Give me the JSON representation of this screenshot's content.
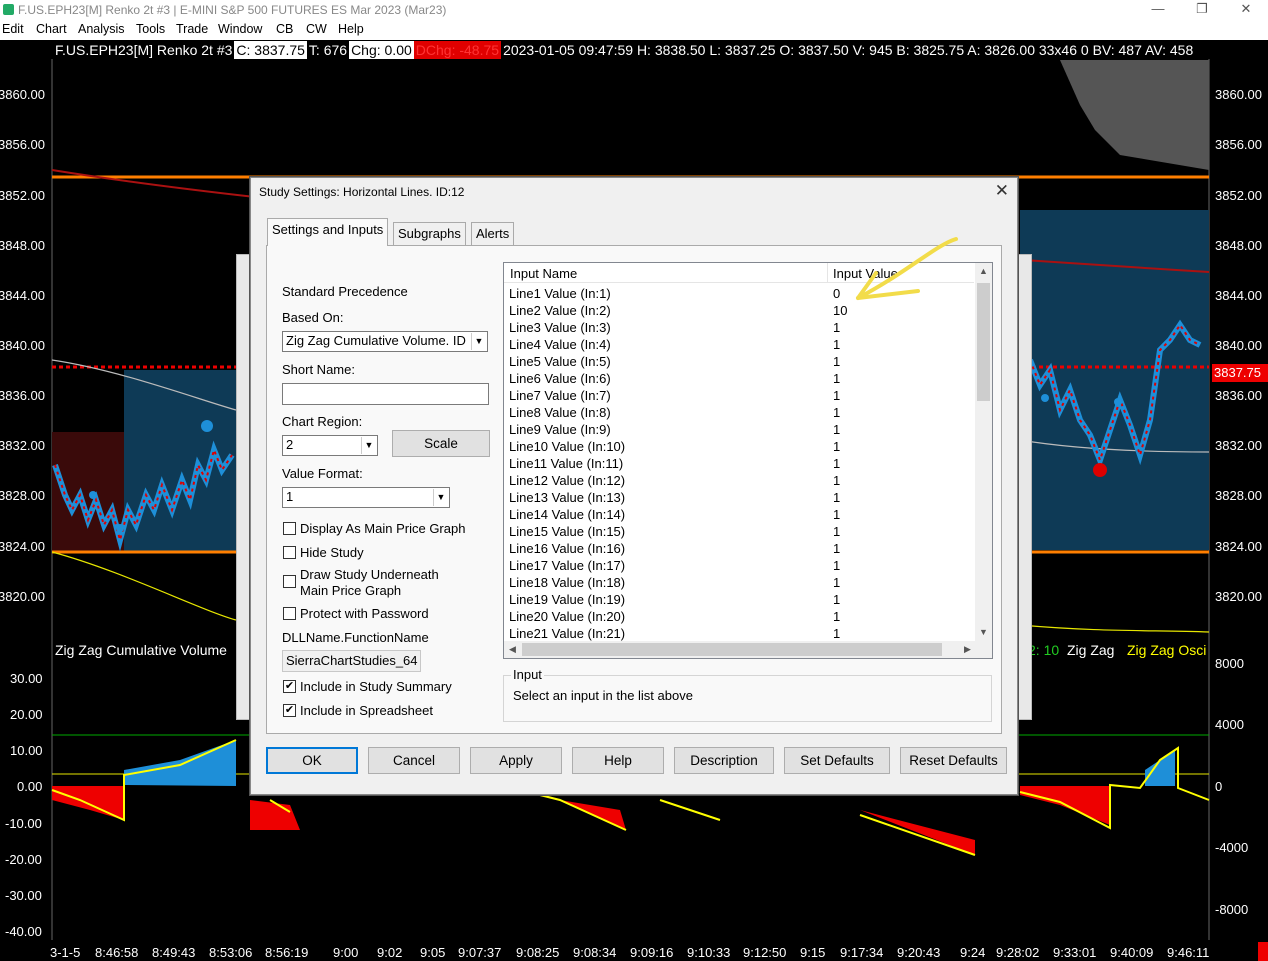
{
  "window": {
    "title": "F.US.EPH23[M]  Renko 2t  #3 | E-MINI S&P 500 FUTURES ES Mar 2023 (Mar23)",
    "minimize": "—",
    "restore": "❐",
    "close": "✕"
  },
  "menu": [
    "Edit",
    "Chart",
    "Analysis",
    "Tools",
    "Trade",
    "Window",
    "CB",
    "CW",
    "Help"
  ],
  "infobar": {
    "symbol": "F.US.EPH23[M]  Renko 2t  #3",
    "close": "C: 3837.75",
    "ticks": "T: 676",
    "chg": "Chg: 0.00",
    "dchg": "DChg: -48.75",
    "rest": "2023-01-05 09:47:59 H: 3838.50 L: 3837.25 O: 3837.50 V: 945 B: 3825.75 A: 3826.00 33x46 0 BV: 487 AV: 458"
  },
  "price_axis_right": [
    "3860.00",
    "3856.00",
    "3852.00",
    "3848.00",
    "3844.00",
    "3840.00",
    "3836.00",
    "3832.00",
    "3828.00",
    "3824.00",
    "3820.00"
  ],
  "price_axis_left": [
    "3860.00",
    "3856.00",
    "3852.00",
    "3848.00",
    "3844.00",
    "3840.00",
    "3836.00",
    "3832.00",
    "3828.00",
    "3824.00",
    "3820.00"
  ],
  "current_price": "3837.75",
  "osc_axis_left": [
    "30.00",
    "20.00",
    "10.00",
    "0.00",
    "-10.00",
    "-20.00",
    "-30.00",
    "-40.00"
  ],
  "osc_axis_right": [
    "8000",
    "4000",
    "0",
    "-4000",
    "-8000"
  ],
  "time_axis": [
    "3-1-5",
    "8:46:58",
    "8:49:43",
    "8:53:06",
    "8:56:19",
    "9:00",
    "9:02",
    "9:05",
    "9:07:37",
    "9:08:25",
    "9:08:34",
    "9:09:16",
    "9:10:33",
    "9:12:50",
    "9:15",
    "9:17:34",
    "9:20:43",
    "9:24",
    "9:28:02",
    "9:33:01",
    "9:40:09",
    "9:46:11"
  ],
  "region_labels": {
    "left": "Zig Zag Cumulative Volume",
    "right_value": "2: 10",
    "zigzag": "Zig Zag",
    "osc": "Zig Zag Osci"
  },
  "dialog": {
    "title": "Study Settings: Horizontal Lines. ID:12",
    "close": "✕",
    "tabs": [
      "Settings and Inputs",
      "Subgraphs",
      "Alerts"
    ],
    "standard_precedence": "Standard Precedence",
    "based_on_label": "Based On:",
    "based_on_value": "Zig Zag Cumulative Volume. ID",
    "short_name_label": "Short Name:",
    "short_name_value": "",
    "chart_region_label": "Chart Region:",
    "chart_region_value": "2",
    "scale_button": "Scale",
    "value_format_label": "Value Format:",
    "value_format_value": "1",
    "checkboxes": [
      {
        "label": "Display As Main Price Graph",
        "checked": false
      },
      {
        "label": "Hide Study",
        "checked": false
      },
      {
        "label": "Draw Study Underneath",
        "label2": "Main Price Graph",
        "checked": false
      },
      {
        "label": "Protect with Password",
        "checked": false
      }
    ],
    "dll_label": "DLLName.FunctionName",
    "dll_value": "SierraChartStudies_64",
    "include_summary": {
      "label": "Include in Study Summary",
      "checked": true
    },
    "include_spreadsheet": {
      "label": "Include in Spreadsheet",
      "checked": true
    },
    "list_headers": {
      "name": "Input Name",
      "value": "Input Value"
    },
    "inputs": [
      {
        "name": "Line1 Value  (In:1)",
        "value": "0"
      },
      {
        "name": "Line2 Value  (In:2)",
        "value": "10"
      },
      {
        "name": "Line3 Value  (In:3)",
        "value": "1"
      },
      {
        "name": "Line4 Value  (In:4)",
        "value": "1"
      },
      {
        "name": "Line5 Value  (In:5)",
        "value": "1"
      },
      {
        "name": "Line6 Value  (In:6)",
        "value": "1"
      },
      {
        "name": "Line7 Value  (In:7)",
        "value": "1"
      },
      {
        "name": "Line8 Value  (In:8)",
        "value": "1"
      },
      {
        "name": "Line9 Value  (In:9)",
        "value": "1"
      },
      {
        "name": "Line10 Value  (In:10)",
        "value": "1"
      },
      {
        "name": "Line11 Value  (In:11)",
        "value": "1"
      },
      {
        "name": "Line12 Value  (In:12)",
        "value": "1"
      },
      {
        "name": "Line13 Value  (In:13)",
        "value": "1"
      },
      {
        "name": "Line14 Value  (In:14)",
        "value": "1"
      },
      {
        "name": "Line15 Value  (In:15)",
        "value": "1"
      },
      {
        "name": "Line16 Value  (In:16)",
        "value": "1"
      },
      {
        "name": "Line17 Value  (In:17)",
        "value": "1"
      },
      {
        "name": "Line18 Value  (In:18)",
        "value": "1"
      },
      {
        "name": "Line19 Value  (In:19)",
        "value": "1"
      },
      {
        "name": "Line20 Value  (In:20)",
        "value": "1"
      },
      {
        "name": "Line21 Value  (In:21)",
        "value": "1"
      }
    ],
    "input_group_label": "Input",
    "input_group_text": "Select an input in the list above",
    "buttons": [
      "OK",
      "Cancel",
      "Apply",
      "Help",
      "Description",
      "Set Defaults",
      "Reset Defaults"
    ]
  },
  "colors": {
    "accent_orange": "#ff7f00",
    "dark_red": "#aa1111",
    "bar_blue": "#1e8fd8",
    "bar_red": "#dd0000",
    "osc_yellow": "#ffff00",
    "highlight_arrow": "#f2dc4a"
  }
}
